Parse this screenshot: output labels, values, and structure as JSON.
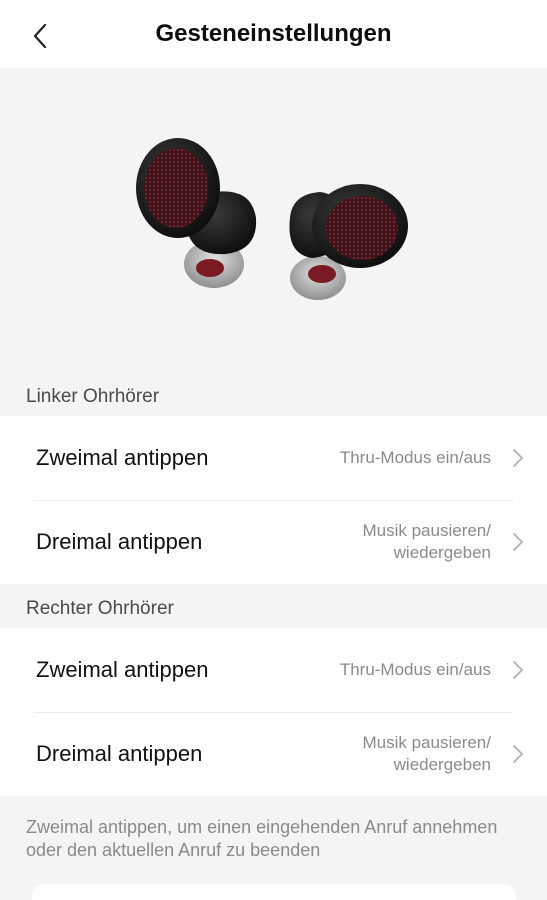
{
  "header": {
    "title": "Gesteneinstellungen",
    "back_icon": "chevron-left-icon"
  },
  "hero": {
    "image": "earbuds-product-image",
    "colors": {
      "shell": "#1a1a1a",
      "mesh": "#6b1f25",
      "tip": "#b9b9b9"
    }
  },
  "left": {
    "section_label": "Linker Ohrhörer",
    "rows": [
      {
        "label": "Zweimal antippen",
        "value_line1": "Thru-Modus ein/aus",
        "value_line2": ""
      },
      {
        "label": "Dreimal antippen",
        "value_line1": "Musik pausieren/",
        "value_line2": "wiedergeben"
      }
    ]
  },
  "right": {
    "section_label": "Rechter Ohrhörer",
    "rows": [
      {
        "label": "Zweimal antippen",
        "value_line1": "Thru-Modus ein/aus",
        "value_line2": ""
      },
      {
        "label": "Dreimal antippen",
        "value_line1": "Musik pausieren/",
        "value_line2": "wiedergeben"
      }
    ]
  },
  "footnote": "Zweimal antippen, um einen eingehenden Anruf annehmen oder den aktuellen Anruf zu beenden"
}
